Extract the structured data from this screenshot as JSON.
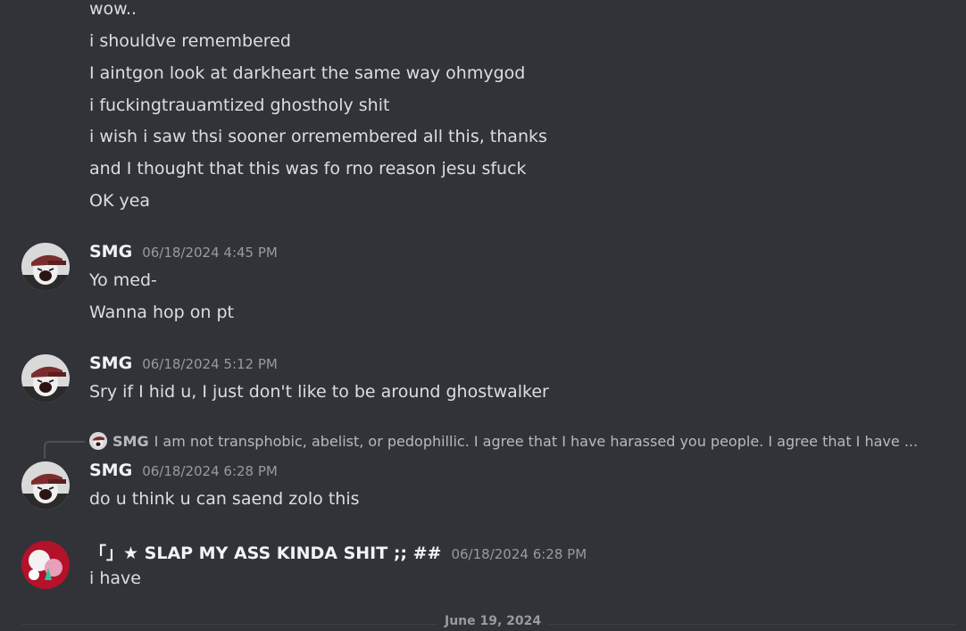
{
  "continued_lines": [
    "wow..",
    "i shouldve remembered",
    "I aintgon look at darkheart the same way ohmygod",
    "i fuckingtrauamtized ghostholy shit",
    "i wish i saw thsi sooner orremembered all this, thanks",
    "and I thought that this was fo rno reason jesu sfuck",
    "OK yea"
  ],
  "messages": [
    {
      "author": "SMG",
      "timestamp": "06/18/2024 4:45 PM",
      "lines": [
        "Yo med-",
        "Wanna hop on pt"
      ]
    },
    {
      "author": "SMG",
      "timestamp": "06/18/2024 5:12 PM",
      "lines": [
        "Sry if I hid u, I just don't like to be around ghostwalker"
      ]
    },
    {
      "reply": {
        "author": "SMG",
        "text": "I am not transphobic, abelist, or pedophillic. I agree that I have harassed you people. I agree that I have ..."
      },
      "author": "SMG",
      "timestamp": "06/18/2024 6:28 PM",
      "lines": [
        "do u think u can saend zolo this"
      ]
    },
    {
      "author": "「」★ SLAP MY ASS KINDA SHIT ;; ##",
      "timestamp": "06/18/2024 6:28 PM",
      "lines": [
        "i have"
      ]
    }
  ],
  "date_divider": "June 19, 2024",
  "colors": {
    "background": "#323339",
    "text": "#dbdee1",
    "author": "#f2f3f5",
    "timestamp": "#949ba4",
    "second_avatar": "#b3122a"
  }
}
